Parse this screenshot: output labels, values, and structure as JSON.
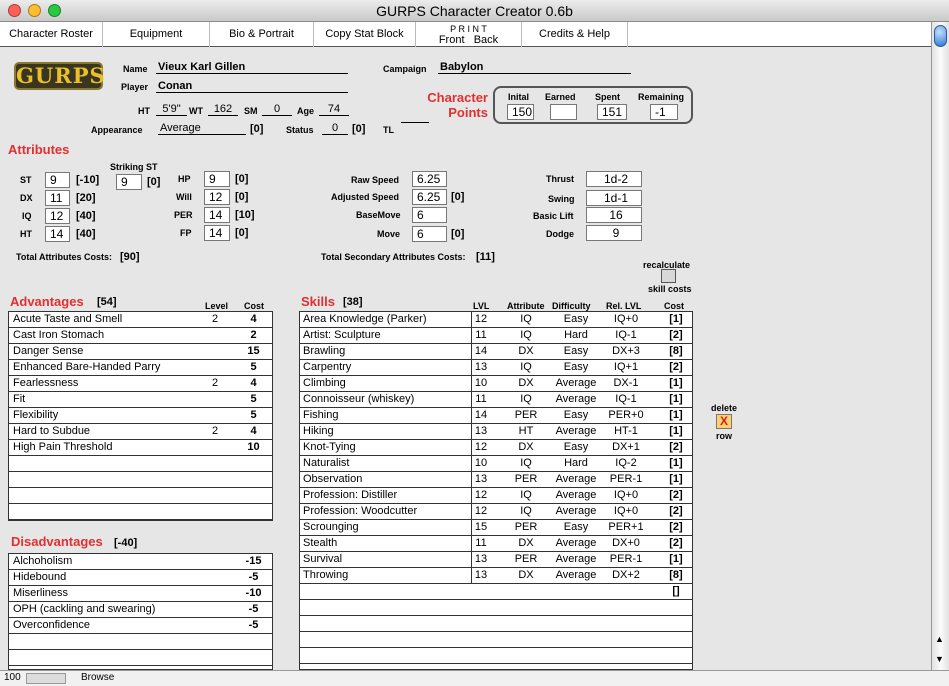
{
  "window": {
    "title": "GURPS Character Creator 0.6b"
  },
  "nav": {
    "character_roster": "Character Roster",
    "equipment": "Equipment",
    "bio_portrait": "Bio & Portrait",
    "copy_stat_block": "Copy Stat Block",
    "print": "P R I N T",
    "print_front": "Front",
    "print_back": "Back",
    "credits_help": "Credits & Help"
  },
  "logo": {
    "text": "GURPS"
  },
  "header": {
    "name_label": "Name",
    "name": "Vieux Karl Gillen",
    "player_label": "Player",
    "player": "Conan",
    "campaign_label": "Campaign",
    "campaign": "Babylon",
    "ht_label": "HT",
    "height": "5'9\"",
    "wt_label": "WT",
    "weight": "162",
    "sm_label": "SM",
    "sm": "0",
    "age_label": "Age",
    "age": "74",
    "appearance_label": "Appearance",
    "appearance": "Average",
    "appearance_cost": "[0]",
    "status_label": "Status",
    "status": "0",
    "status_cost": "[0]",
    "tl_label": "TL",
    "tl": ""
  },
  "points": {
    "title_line1": "Character",
    "title_line2": "Points",
    "initial_label": "Inital",
    "initial": "150",
    "earned_label": "Earned",
    "earned": "",
    "spent_label": "Spent",
    "spent": "151",
    "remaining_label": "Remaining",
    "remaining": "-1"
  },
  "attributes": {
    "title": "Attributes",
    "striking_st_label": "Striking ST",
    "striking_st": "9",
    "striking_st_cost": "[0]",
    "st_label": "ST",
    "st": "9",
    "st_cost": "[-10]",
    "dx_label": "DX",
    "dx": "11",
    "dx_cost": "[20]",
    "iq_label": "IQ",
    "iq": "12",
    "iq_cost": "[40]",
    "ht_label": "HT",
    "ht": "14",
    "ht_cost": "[40]",
    "hp_label": "HP",
    "hp": "9",
    "hp_cost": "[0]",
    "will_label": "Will",
    "will": "12",
    "will_cost": "[0]",
    "per_label": "PER",
    "per": "14",
    "per_cost": "[10]",
    "fp_label": "FP",
    "fp": "14",
    "fp_cost": "[0]",
    "total_label": "Total Attributes Costs:",
    "total": "[90]"
  },
  "secondary": {
    "raw_speed_label": "Raw Speed",
    "raw_speed": "6.25",
    "adj_speed_label": "Adjusted Speed",
    "adj_speed": "6.25",
    "adj_speed_cost": "[0]",
    "basemove_label": "BaseMove",
    "basemove": "6",
    "move_label": "Move",
    "move": "6",
    "move_cost": "[0]",
    "total_label": "Total Secondary Attributes  Costs:",
    "total": "[11]",
    "thrust_label": "Thrust",
    "thrust": "1d-2",
    "swing_label": "Swing",
    "swing": "1d-1",
    "basic_lift_label": "Basic Lift",
    "basic_lift": "16",
    "dodge_label": "Dodge",
    "dodge": "9"
  },
  "recalc": {
    "line1": "recalculate",
    "line2": "skill costs"
  },
  "advantages": {
    "title": "Advantages",
    "total": "[54]",
    "level_header": "Level",
    "cost_header": "Cost",
    "items": [
      {
        "name": "Acute Taste and Smell",
        "level": "2",
        "cost": "4"
      },
      {
        "name": "Cast Iron Stomach",
        "level": "",
        "cost": "2"
      },
      {
        "name": "Danger Sense",
        "level": "",
        "cost": "15"
      },
      {
        "name": "Enhanced Bare-Handed Parry",
        "level": "",
        "cost": "5"
      },
      {
        "name": "Fearlessness",
        "level": "2",
        "cost": "4"
      },
      {
        "name": "Fit",
        "level": "",
        "cost": "5"
      },
      {
        "name": "Flexibility",
        "level": "",
        "cost": "5"
      },
      {
        "name": "Hard to Subdue",
        "level": "2",
        "cost": "4"
      },
      {
        "name": "High Pain Threshold",
        "level": "",
        "cost": "10"
      }
    ]
  },
  "disadvantages": {
    "title": "Disadvantages",
    "total": "[-40]",
    "items": [
      {
        "name": "Alchoholism",
        "cost": "-15"
      },
      {
        "name": "Hidebound",
        "cost": "-5"
      },
      {
        "name": "Miserliness",
        "cost": "-10"
      },
      {
        "name": "OPH (cackling and swearing)",
        "cost": "-5"
      },
      {
        "name": "Overconfidence",
        "cost": "-5"
      }
    ]
  },
  "skills": {
    "title": "Skills",
    "total": "[38]",
    "lvl_header": "LVL",
    "attribute_header": "Attribute",
    "difficulty_header": "Difficulty",
    "rel_header": "Rel. LVL",
    "cost_header": "Cost",
    "blank_cost": "[]",
    "items": [
      {
        "name": "Area Knowledge (Parker)",
        "lvl": "12",
        "attr": "IQ",
        "diff": "Easy",
        "rel": "IQ+0",
        "cost": "[1]"
      },
      {
        "name": "Artist: Sculpture",
        "lvl": "11",
        "attr": "IQ",
        "diff": "Hard",
        "rel": "IQ-1",
        "cost": "[2]"
      },
      {
        "name": "Brawling",
        "lvl": "14",
        "attr": "DX",
        "diff": "Easy",
        "rel": "DX+3",
        "cost": "[8]"
      },
      {
        "name": "Carpentry",
        "lvl": "13",
        "attr": "IQ",
        "diff": "Easy",
        "rel": "IQ+1",
        "cost": "[2]"
      },
      {
        "name": "Climbing",
        "lvl": "10",
        "attr": "DX",
        "diff": "Average",
        "rel": "DX-1",
        "cost": "[1]"
      },
      {
        "name": "Connoisseur (whiskey)",
        "lvl": "11",
        "attr": "IQ",
        "diff": "Average",
        "rel": "IQ-1",
        "cost": "[1]"
      },
      {
        "name": "Fishing",
        "lvl": "14",
        "attr": "PER",
        "diff": "Easy",
        "rel": "PER+0",
        "cost": "[1]"
      },
      {
        "name": "Hiking",
        "lvl": "13",
        "attr": "HT",
        "diff": "Average",
        "rel": "HT-1",
        "cost": "[1]"
      },
      {
        "name": "Knot-Tying",
        "lvl": "12",
        "attr": "DX",
        "diff": "Easy",
        "rel": "DX+1",
        "cost": "[2]"
      },
      {
        "name": "Naturalist",
        "lvl": "10",
        "attr": "IQ",
        "diff": "Hard",
        "rel": "IQ-2",
        "cost": "[1]"
      },
      {
        "name": "Observation",
        "lvl": "13",
        "attr": "PER",
        "diff": "Average",
        "rel": "PER-1",
        "cost": "[1]"
      },
      {
        "name": "Profession: Distiller",
        "lvl": "12",
        "attr": "IQ",
        "diff": "Average",
        "rel": "IQ+0",
        "cost": "[2]"
      },
      {
        "name": "Profession: Woodcutter",
        "lvl": "12",
        "attr": "IQ",
        "diff": "Average",
        "rel": "IQ+0",
        "cost": "[2]"
      },
      {
        "name": "Scrounging",
        "lvl": "15",
        "attr": "PER",
        "diff": "Easy",
        "rel": "PER+1",
        "cost": "[2]"
      },
      {
        "name": "Stealth",
        "lvl": "11",
        "attr": "DX",
        "diff": "Average",
        "rel": "DX+0",
        "cost": "[2]"
      },
      {
        "name": "Survival",
        "lvl": "13",
        "attr": "PER",
        "diff": "Average",
        "rel": "PER-1",
        "cost": "[1]"
      },
      {
        "name": "Throwing",
        "lvl": "13",
        "attr": "DX",
        "diff": "Average",
        "rel": "DX+2",
        "cost": "[8]"
      }
    ]
  },
  "delete_row": {
    "line1": "delete",
    "icon": "X",
    "line2": "row"
  },
  "statusbar": {
    "zoom": "100",
    "mode": "Browse"
  },
  "colors": {
    "accent_red": "#e03030",
    "background": "#e6e6e6",
    "logo_bg": "#3a3520",
    "logo_text": "#e8c02a"
  }
}
